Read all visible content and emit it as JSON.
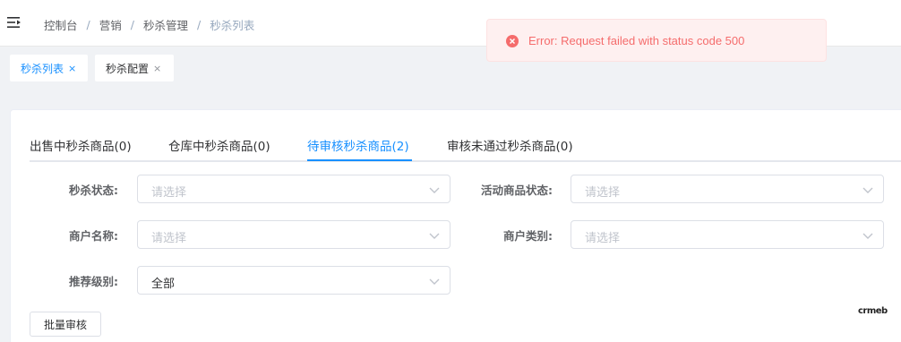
{
  "breadcrumb": [
    "控制台",
    "营销",
    "秒杀管理",
    "秒杀列表"
  ],
  "breadcrumb_separator": "/",
  "tags": [
    {
      "label": "秒杀列表",
      "active": true
    },
    {
      "label": "秒杀配置",
      "active": false
    }
  ],
  "tag_close_glyph": "×",
  "tabs": [
    {
      "label": "出售中秒杀商品(0)",
      "active": false
    },
    {
      "label": "仓库中秒杀商品(0)",
      "active": false
    },
    {
      "label": "待审核秒杀商品(2)",
      "active": true
    },
    {
      "label": "审核未通过秒杀商品(0)",
      "active": false
    }
  ],
  "filters": {
    "seckill_status": {
      "label": "秒杀状态:",
      "placeholder": "请选择"
    },
    "product_status": {
      "label": "活动商品状态:",
      "placeholder": "请选择"
    },
    "merchant_name": {
      "label": "商户名称:",
      "placeholder": "请选择"
    },
    "merchant_type": {
      "label": "商户类别:",
      "placeholder": "请选择"
    },
    "recommend_level": {
      "label": "推荐级别:",
      "value": "全部"
    }
  },
  "batch_review_button": "批量审核",
  "logo_text": "crmeb",
  "toast": {
    "message": "Error: Request failed with status code 500",
    "type": "error"
  },
  "colors": {
    "accent": "#1890ff",
    "error": "#f56c6c",
    "error_bg": "#fef0f0"
  }
}
